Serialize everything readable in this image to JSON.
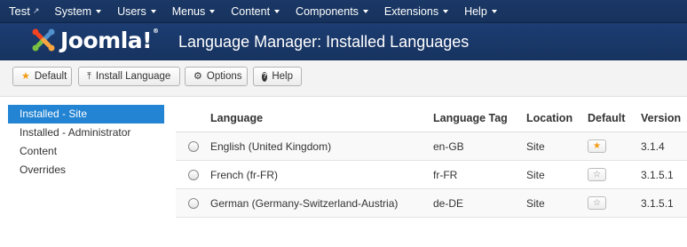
{
  "navbar": {
    "brand": "Test",
    "brand_icon": "external-link-icon",
    "items": [
      {
        "label": "System"
      },
      {
        "label": "Users"
      },
      {
        "label": "Menus"
      },
      {
        "label": "Content"
      },
      {
        "label": "Components"
      },
      {
        "label": "Extensions"
      },
      {
        "label": "Help"
      }
    ]
  },
  "header": {
    "logo_text": "Joomla!",
    "logo_mark": "®",
    "title": "Language Manager: Installed Languages"
  },
  "toolbar": {
    "default_label": "Default",
    "install_label": "Install Language",
    "options_label": "Options",
    "help_label": "Help",
    "default_icon": "★",
    "install_icon": "⤒",
    "options_icon": "⚙",
    "help_icon": "?"
  },
  "sidebar": {
    "items": [
      {
        "label": "Installed - Site",
        "active": true
      },
      {
        "label": "Installed - Administrator",
        "active": false
      },
      {
        "label": "Content",
        "active": false
      },
      {
        "label": "Overrides",
        "active": false
      }
    ]
  },
  "table": {
    "headers": {
      "language": "Language",
      "tag": "Language Tag",
      "location": "Location",
      "default": "Default",
      "version": "Version"
    },
    "rows": [
      {
        "language": "English (United Kingdom)",
        "tag": "en-GB",
        "location": "Site",
        "is_default": true,
        "version": "3.1.4"
      },
      {
        "language": "French (fr-FR)",
        "tag": "fr-FR",
        "location": "Site",
        "is_default": false,
        "version": "3.1.5.1"
      },
      {
        "language": "German (Germany-Switzerland-Austria)",
        "tag": "de-DE",
        "location": "Site",
        "is_default": false,
        "version": "3.1.5.1"
      }
    ]
  },
  "colors": {
    "navbar": "#1b3866",
    "header": "#1c3d73",
    "sidebar_active": "#2384d3",
    "star": "#f39c12"
  }
}
